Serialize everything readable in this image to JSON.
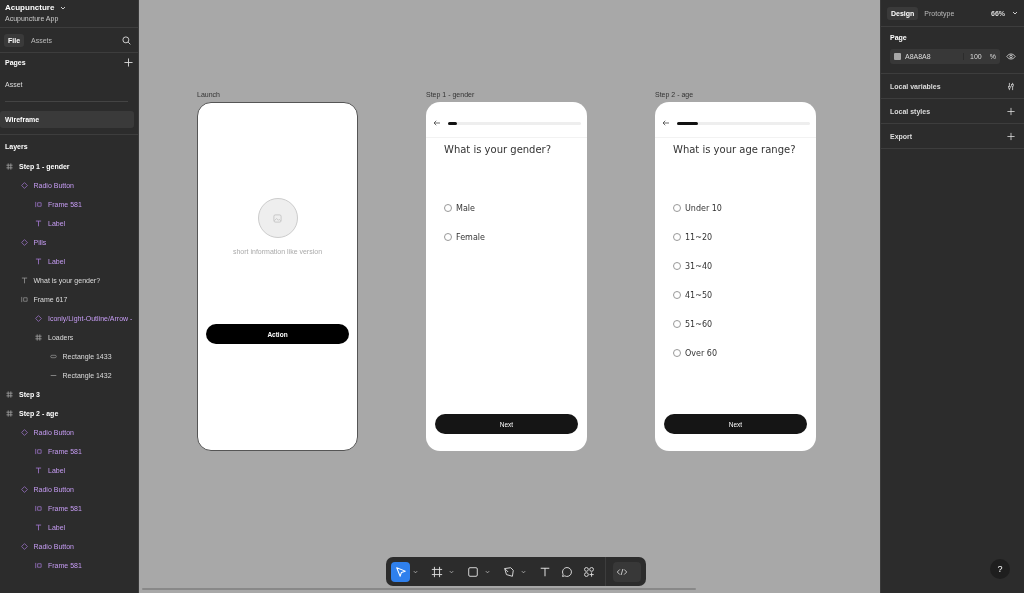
{
  "file": {
    "name": "Acupuncture",
    "project": "Acupuncture App"
  },
  "sidebar_tabs": [
    {
      "label": "File",
      "selected": true
    },
    {
      "label": "Assets",
      "selected": false
    }
  ],
  "pages": {
    "title": "Pages",
    "items": [
      {
        "kind": "page",
        "label": "Asset",
        "selected": false
      },
      {
        "kind": "divider"
      },
      {
        "kind": "page",
        "label": "Wireframe",
        "selected": true
      }
    ]
  },
  "layers": {
    "title": "Layers",
    "items": [
      {
        "kind": "frame",
        "label": "Step 1 - gender",
        "children": [
          {
            "kind": "instance",
            "label": "Radio Button",
            "children": [
              {
                "kind": "autolayout",
                "label": "Frame 581"
              },
              {
                "kind": "text",
                "label": "Label"
              }
            ]
          },
          {
            "kind": "instance",
            "label": "Pills",
            "children": [
              {
                "kind": "text",
                "label": "Label"
              }
            ]
          },
          {
            "kind": "text",
            "label": "What is your gender?"
          },
          {
            "kind": "autolayout",
            "label": "Frame 617",
            "children": [
              {
                "kind": "instance",
                "label": "Iconly/Light-Outline/Arrow -"
              },
              {
                "kind": "frame",
                "label": "Loaders",
                "children": [
                  {
                    "kind": "rectangle",
                    "label": "Rectangle 1433"
                  },
                  {
                    "kind": "line",
                    "label": "Rectangle 1432"
                  }
                ]
              }
            ]
          }
        ]
      },
      {
        "kind": "frame",
        "label": "Step 3"
      },
      {
        "kind": "frame",
        "label": "Step 2 -  age",
        "children": [
          {
            "kind": "instance",
            "label": "Radio Button",
            "children": [
              {
                "kind": "autolayout",
                "label": "Frame 581"
              },
              {
                "kind": "text",
                "label": "Label"
              }
            ]
          },
          {
            "kind": "instance",
            "label": "Radio Button",
            "children": [
              {
                "kind": "autolayout",
                "label": "Frame 581"
              },
              {
                "kind": "text",
                "label": "Label"
              }
            ]
          },
          {
            "kind": "instance",
            "label": "Radio Button",
            "children": [
              {
                "kind": "autolayout",
                "label": "Frame 581"
              }
            ]
          }
        ]
      }
    ]
  },
  "canvas": {
    "frames": [
      {
        "kind": "launch",
        "title": "Launch",
        "caption": "short information like version",
        "button": "Action"
      },
      {
        "kind": "question",
        "title": "Step 1 - gender",
        "level": 0.07,
        "question": "What is your gender?",
        "options": [
          {
            "label": "Male",
            "selected": false
          },
          {
            "label": "Female",
            "selected": false
          }
        ],
        "button": "Next"
      },
      {
        "kind": "question",
        "title": "Step 2 -  age",
        "level": 0.16,
        "question": "What is your age range?",
        "options": [
          {
            "label": "Under 10",
            "selected": false
          },
          {
            "label": "11~20",
            "selected": false
          },
          {
            "label": "31~40",
            "selected": false
          },
          {
            "label": "41~50",
            "selected": false
          },
          {
            "label": "51~60",
            "selected": false
          },
          {
            "label": "Over 60",
            "selected": false
          }
        ],
        "button": "Next"
      }
    ]
  },
  "toolbar": {
    "tools": [
      {
        "kind": "move",
        "selected": true,
        "dropdown": true
      },
      {
        "kind": "frame",
        "selected": false,
        "dropdown": true
      },
      {
        "kind": "shape",
        "selected": false,
        "dropdown": true
      },
      {
        "kind": "pen",
        "selected": false,
        "dropdown": true
      },
      {
        "kind": "text",
        "selected": false,
        "dropdown": false
      },
      {
        "kind": "comment",
        "selected": false,
        "dropdown": false
      },
      {
        "kind": "actions",
        "selected": false,
        "dropdown": false
      },
      {
        "kind": "code",
        "selected": false,
        "dropdown": false
      }
    ]
  },
  "right_panel": {
    "tabs": [
      {
        "label": "Design",
        "selected": true
      },
      {
        "label": "Prototype",
        "selected": false
      }
    ],
    "zoom": "66%",
    "page": {
      "title": "Page",
      "color": "A8A8A8",
      "opacity": "100",
      "unit": "%"
    },
    "sections": [
      {
        "kind": "variables",
        "label": "Local variables"
      },
      {
        "kind": "add",
        "label": "Local styles"
      },
      {
        "kind": "add",
        "label": "Export"
      }
    ]
  },
  "help": "?"
}
